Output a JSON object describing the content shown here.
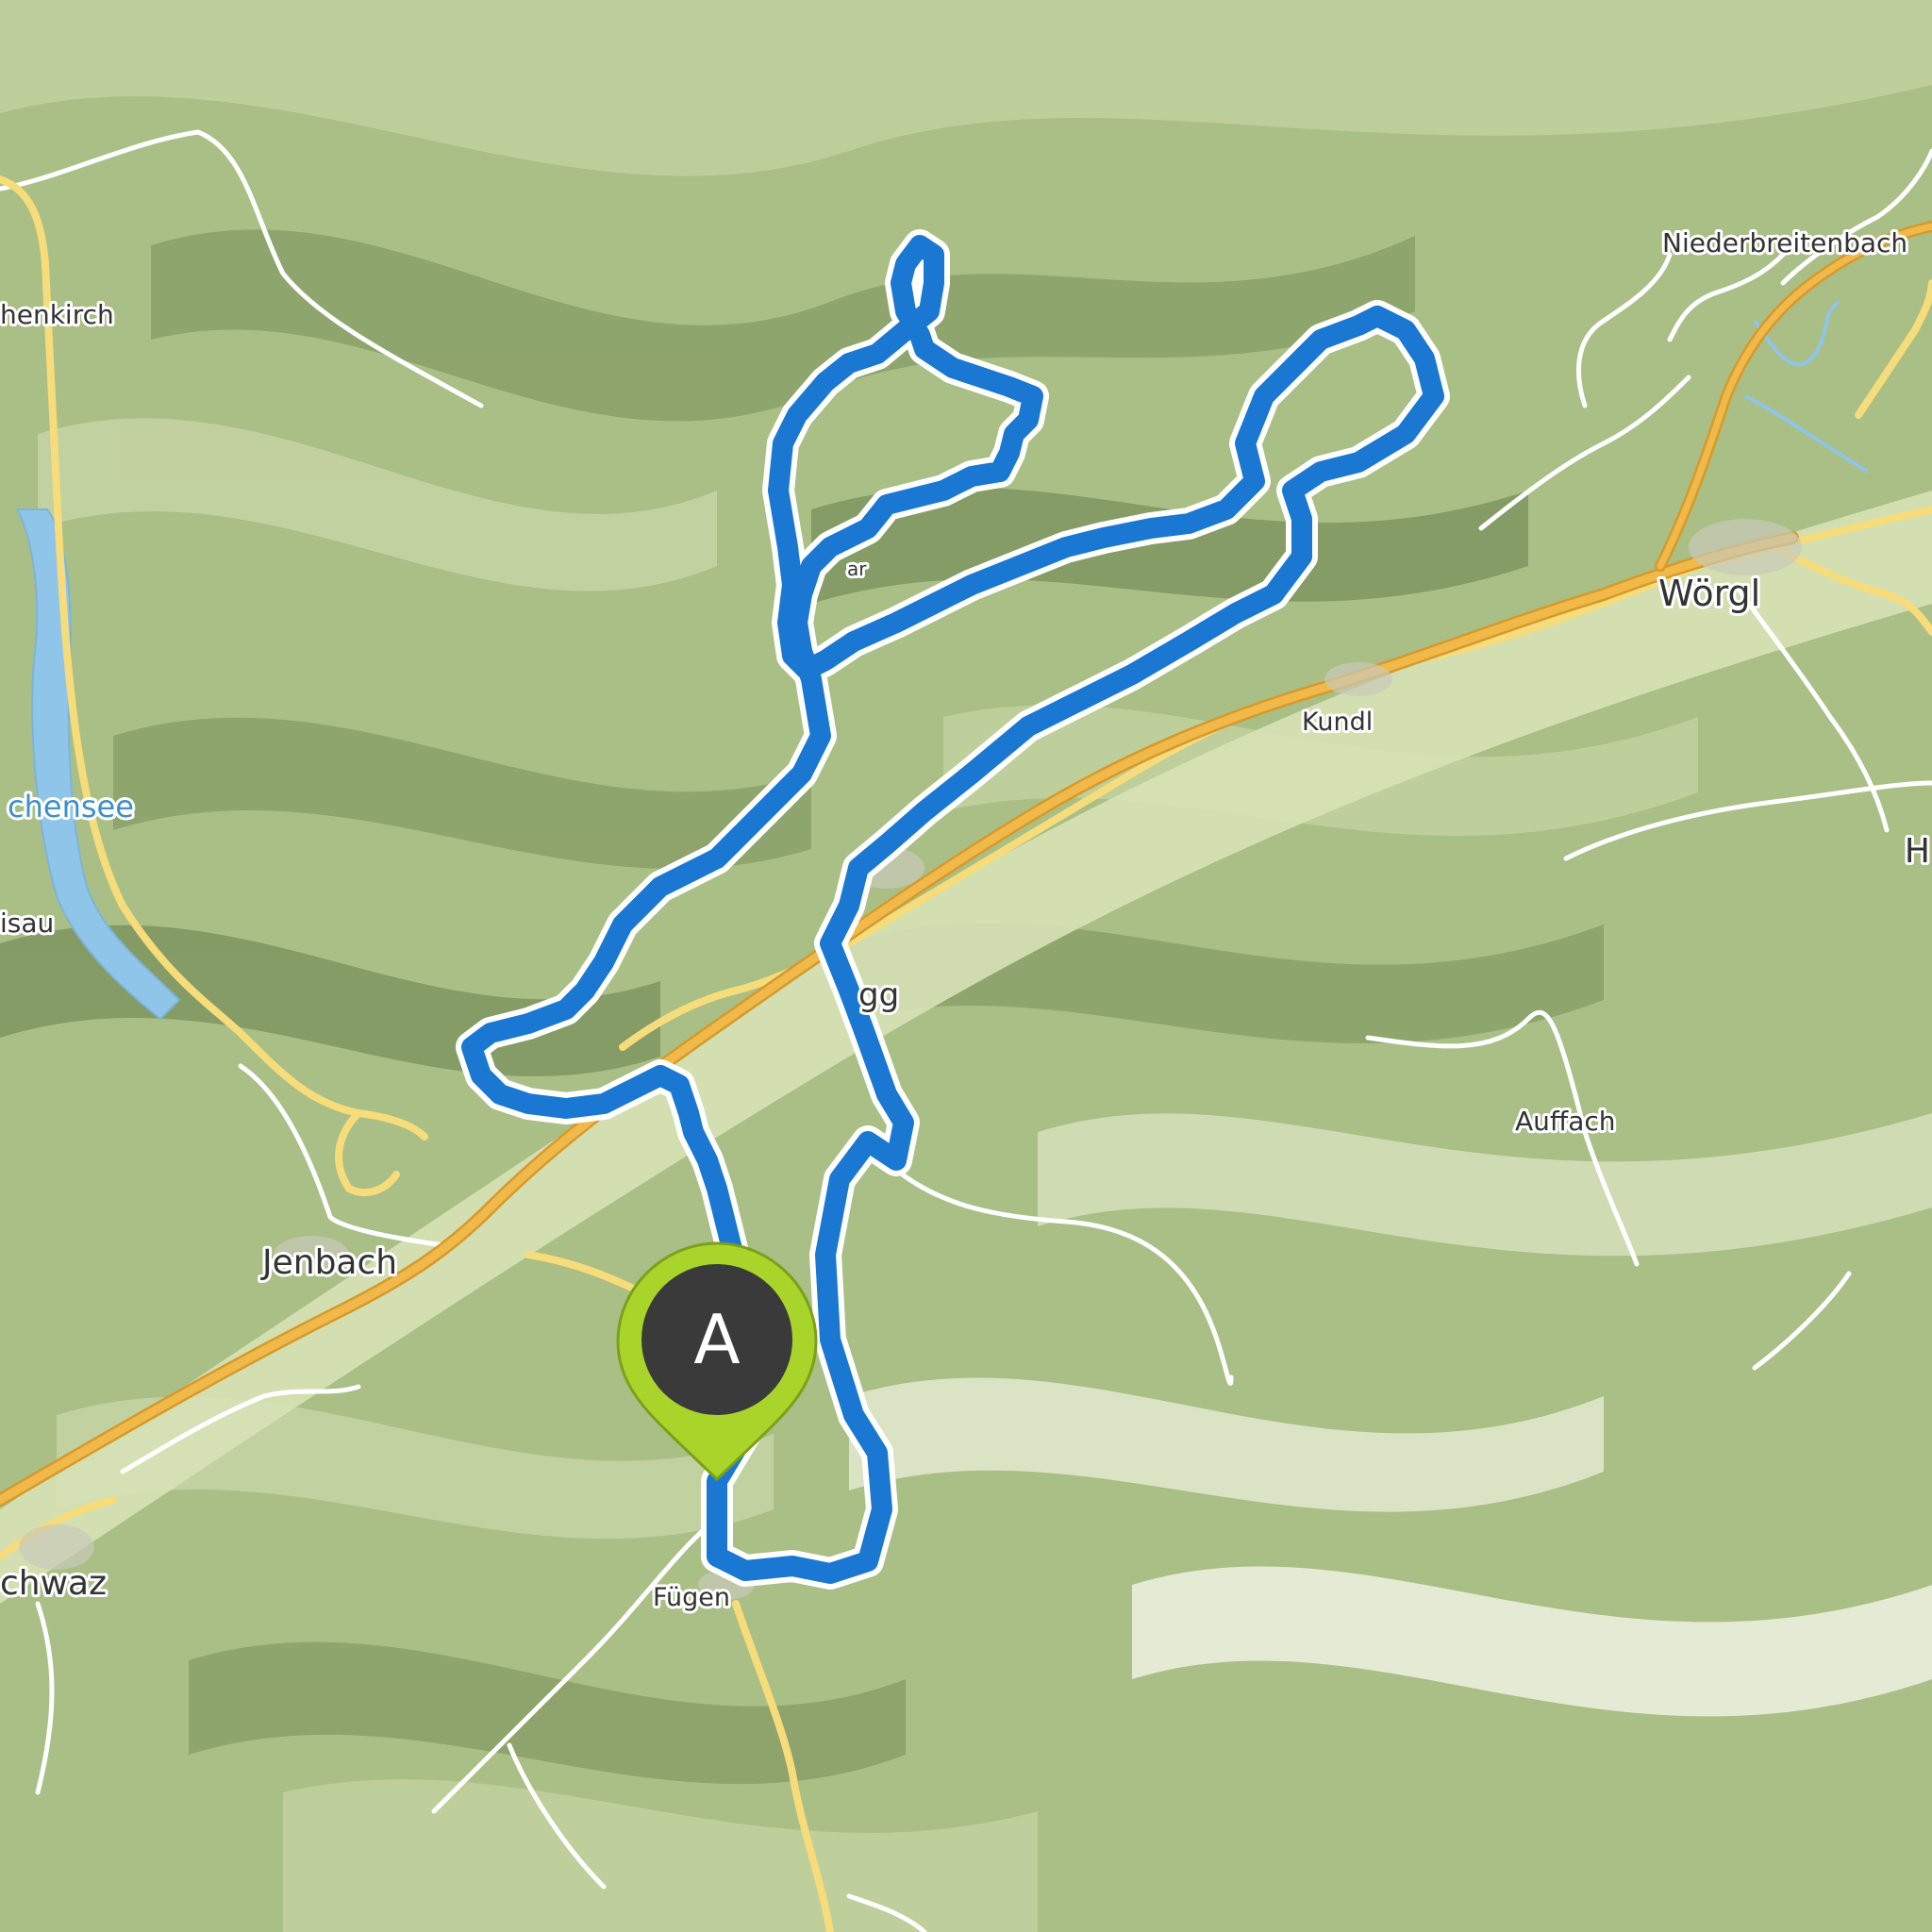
{
  "map": {
    "places": [
      {
        "id": "niederbreitenbach",
        "name": "Niederbreitenbach"
      },
      {
        "id": "achenkirch",
        "name": "henkirch"
      },
      {
        "id": "woergl",
        "name": "Wörgl"
      },
      {
        "id": "kundl",
        "name": "Kundl"
      },
      {
        "id": "achensee",
        "name": "chensee"
      },
      {
        "id": "maurach",
        "name": "isau"
      },
      {
        "id": "rattenberg",
        "name": "gg"
      },
      {
        "id": "auffach",
        "name": "Auffach"
      },
      {
        "id": "jenbach",
        "name": "Jenbach"
      },
      {
        "id": "schwaz",
        "name": "chwaz"
      },
      {
        "id": "fuegen",
        "name": "Fügen"
      },
      {
        "id": "edge-right",
        "name": "H"
      },
      {
        "id": "route-overlap",
        "name": "ar"
      }
    ],
    "start_marker": {
      "label": "A"
    },
    "colors": {
      "terrain_base": "#a9bf86",
      "terrain_light": "#cdd9ad",
      "terrain_dark": "#7f9560",
      "route": "#1a78d2",
      "motorway": "#f1b84a",
      "major_road": "#f6dc7a",
      "minor_road": "#ffffff",
      "water": "#8ec5e8",
      "marker_fill": "#3a3a3a",
      "marker_ring": "#a9d52b"
    }
  }
}
